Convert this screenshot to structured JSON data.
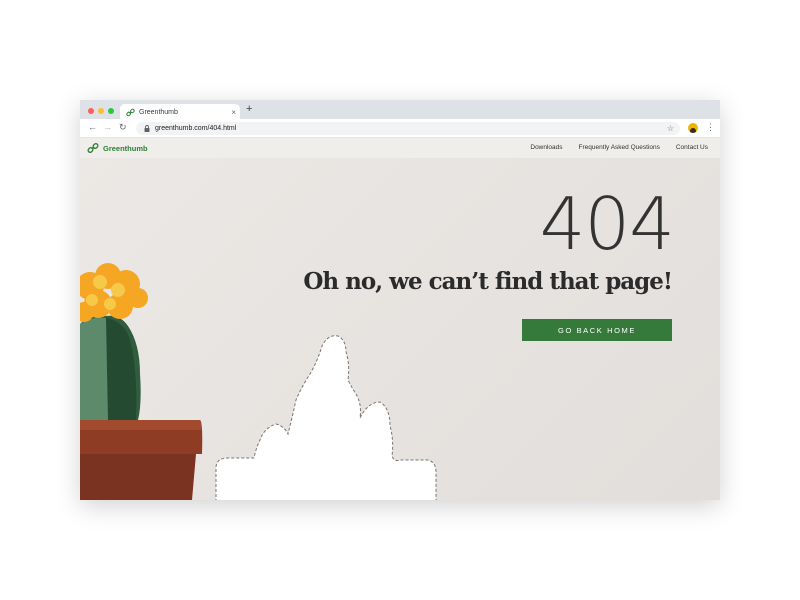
{
  "browser": {
    "tab_title": "Greenthumb",
    "tab_close": "×",
    "new_tab": "+",
    "url": "greenthumb.com/404.html",
    "back": "←",
    "forward": "→",
    "reload": "↻",
    "star": "☆",
    "menu": "⋮",
    "traffic_lights": [
      "#fe5f57",
      "#febc2e",
      "#28c840"
    ]
  },
  "site": {
    "brand_name": "Greenthumb",
    "brand_color": "#2e7d32",
    "nav_links": [
      "Downloads",
      "Frequently Asked Questions",
      "Contact Us"
    ]
  },
  "error": {
    "code": "404",
    "headline": "Oh no, we can’t find that page!",
    "button_label": "GO BACK HOME",
    "button_color": "#357a3a"
  },
  "icons": {
    "favicon": "link-chain-icon",
    "lock": "lock-icon",
    "logo": "link-chain-icon"
  }
}
